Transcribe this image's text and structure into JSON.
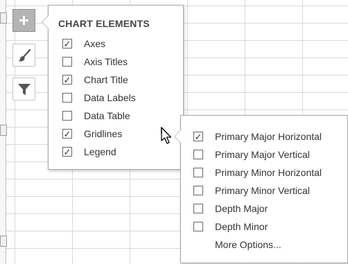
{
  "colors": {
    "grid_line": "#d9d9d9",
    "active_button": "#b4b4b4",
    "panel_border": "#a9a9a9",
    "text": "#333333"
  },
  "side_tools": [
    {
      "name": "chart-elements-button",
      "icon": "plus-icon",
      "glyph": "+",
      "active": true
    },
    {
      "name": "chart-styles-button",
      "icon": "paintbrush-icon",
      "active": false
    },
    {
      "name": "chart-filters-button",
      "icon": "filter-icon",
      "active": false
    }
  ],
  "chart_elements": {
    "title": "CHART ELEMENTS",
    "items": [
      {
        "label": "Axes",
        "checked": true,
        "mark": "✓"
      },
      {
        "label": "Axis Titles",
        "checked": false,
        "mark": ""
      },
      {
        "label": "Chart Title",
        "checked": true,
        "mark": "✓"
      },
      {
        "label": "Data Labels",
        "checked": false,
        "mark": ""
      },
      {
        "label": "Data Table",
        "checked": false,
        "mark": ""
      },
      {
        "label": "Gridlines",
        "checked": true,
        "mark": "✓"
      },
      {
        "label": "Legend",
        "checked": true,
        "mark": "✓"
      }
    ]
  },
  "gridlines_submenu": {
    "items": [
      {
        "label": "Primary Major Horizontal",
        "checked": true,
        "mark": "✓"
      },
      {
        "label": "Primary Major Vertical",
        "checked": false,
        "mark": ""
      },
      {
        "label": "Primary Minor Horizontal",
        "checked": false,
        "mark": ""
      },
      {
        "label": "Primary Minor Vertical",
        "checked": false,
        "mark": ""
      },
      {
        "label": "Depth Major",
        "checked": false,
        "mark": ""
      },
      {
        "label": "Depth Minor",
        "checked": false,
        "mark": ""
      }
    ],
    "more_options": "More Options..."
  }
}
